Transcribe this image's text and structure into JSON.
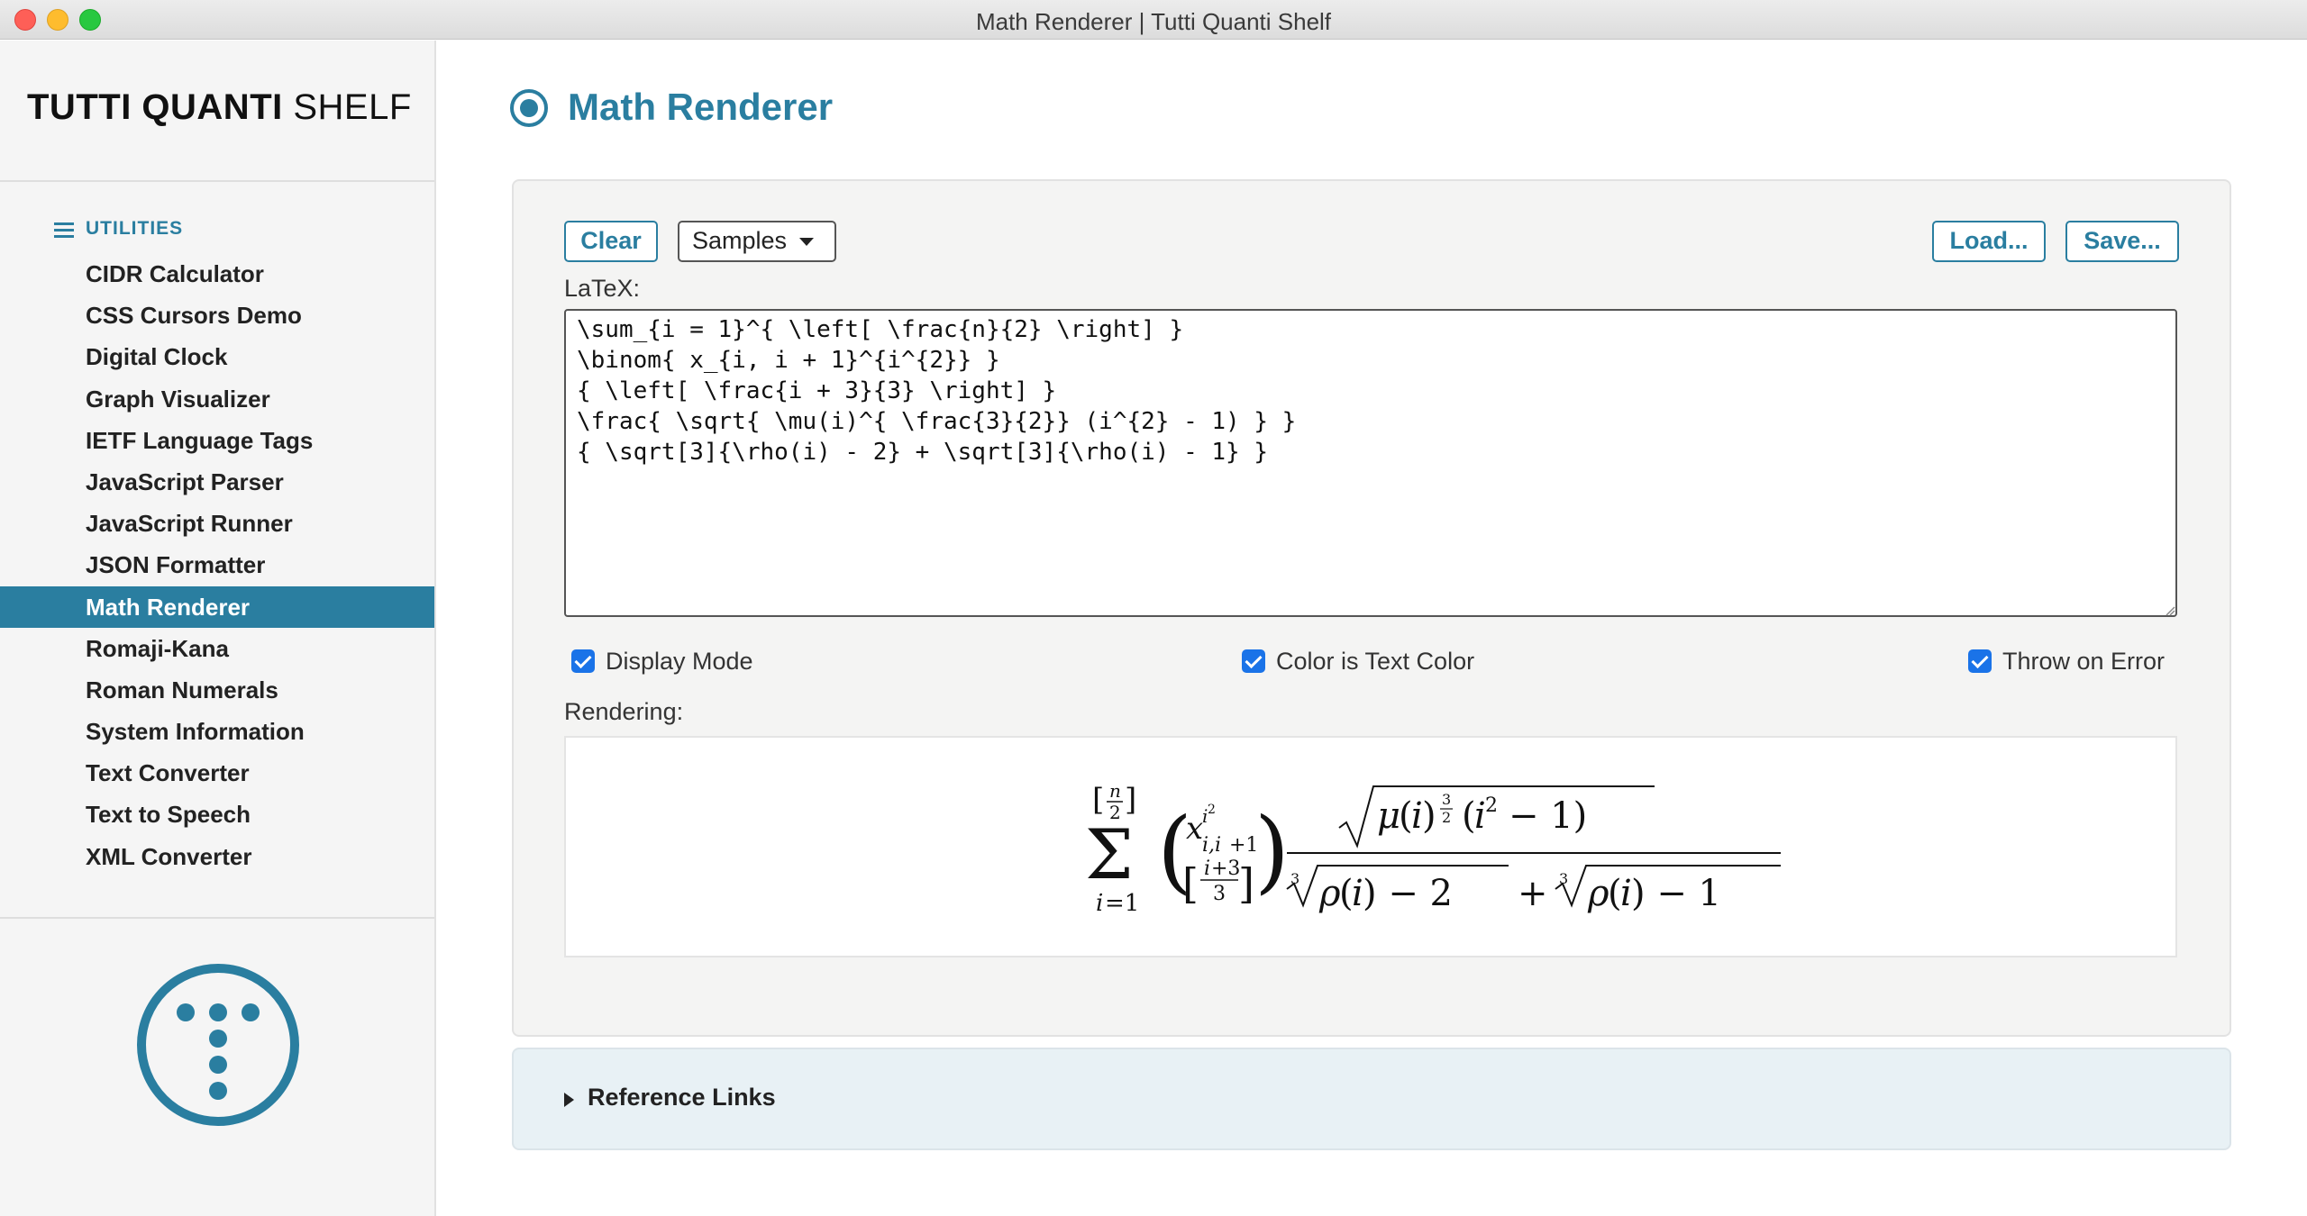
{
  "window": {
    "title": "Math Renderer | Tutti Quanti Shelf"
  },
  "sidebar": {
    "brand_bold": "TUTTI QUANTI",
    "brand_light": "SHELF",
    "section": "UTILITIES",
    "items": [
      {
        "label": "CIDR Calculator"
      },
      {
        "label": "CSS Cursors Demo"
      },
      {
        "label": "Digital Clock"
      },
      {
        "label": "Graph Visualizer"
      },
      {
        "label": "IETF Language Tags"
      },
      {
        "label": "JavaScript Parser"
      },
      {
        "label": "JavaScript Runner"
      },
      {
        "label": "JSON Formatter"
      },
      {
        "label": "Math Renderer"
      },
      {
        "label": "Romaji-Kana"
      },
      {
        "label": "Roman Numerals"
      },
      {
        "label": "System Information"
      },
      {
        "label": "Text Converter"
      },
      {
        "label": "Text to Speech"
      },
      {
        "label": "XML Converter"
      }
    ],
    "active_item": "Math Renderer"
  },
  "main": {
    "title": "Math Renderer",
    "toolbar": {
      "clear_label": "Clear",
      "samples_label": "Samples",
      "load_label": "Load...",
      "save_label": "Save..."
    },
    "latex_label": "LaTeX:",
    "latex_value": "\\sum_{i = 1}^{ \\left[ \\frac{n}{2} \\right] }\n\\binom{ x_{i, i + 1}^{i^{2}} }\n{ \\left[ \\frac{i + 3}{3} \\right] }\n\\frac{ \\sqrt{ \\mu(i)^{ \\frac{3}{2}} (i^{2} - 1) } }\n{ \\sqrt[3]{\\rho(i) - 2} + \\sqrt[3]{\\rho(i) - 1} }",
    "options": {
      "display_mode": {
        "label": "Display Mode",
        "checked": true
      },
      "color_is_text_color": {
        "label": "Color is Text Color",
        "checked": true
      },
      "throw_on_error": {
        "label": "Throw on Error",
        "checked": true
      }
    },
    "rendering_label": "Rendering:",
    "reference_links_label": "Reference Links"
  },
  "colors": {
    "accent": "#2a7ea0",
    "checkbox": "#1a73e8"
  }
}
